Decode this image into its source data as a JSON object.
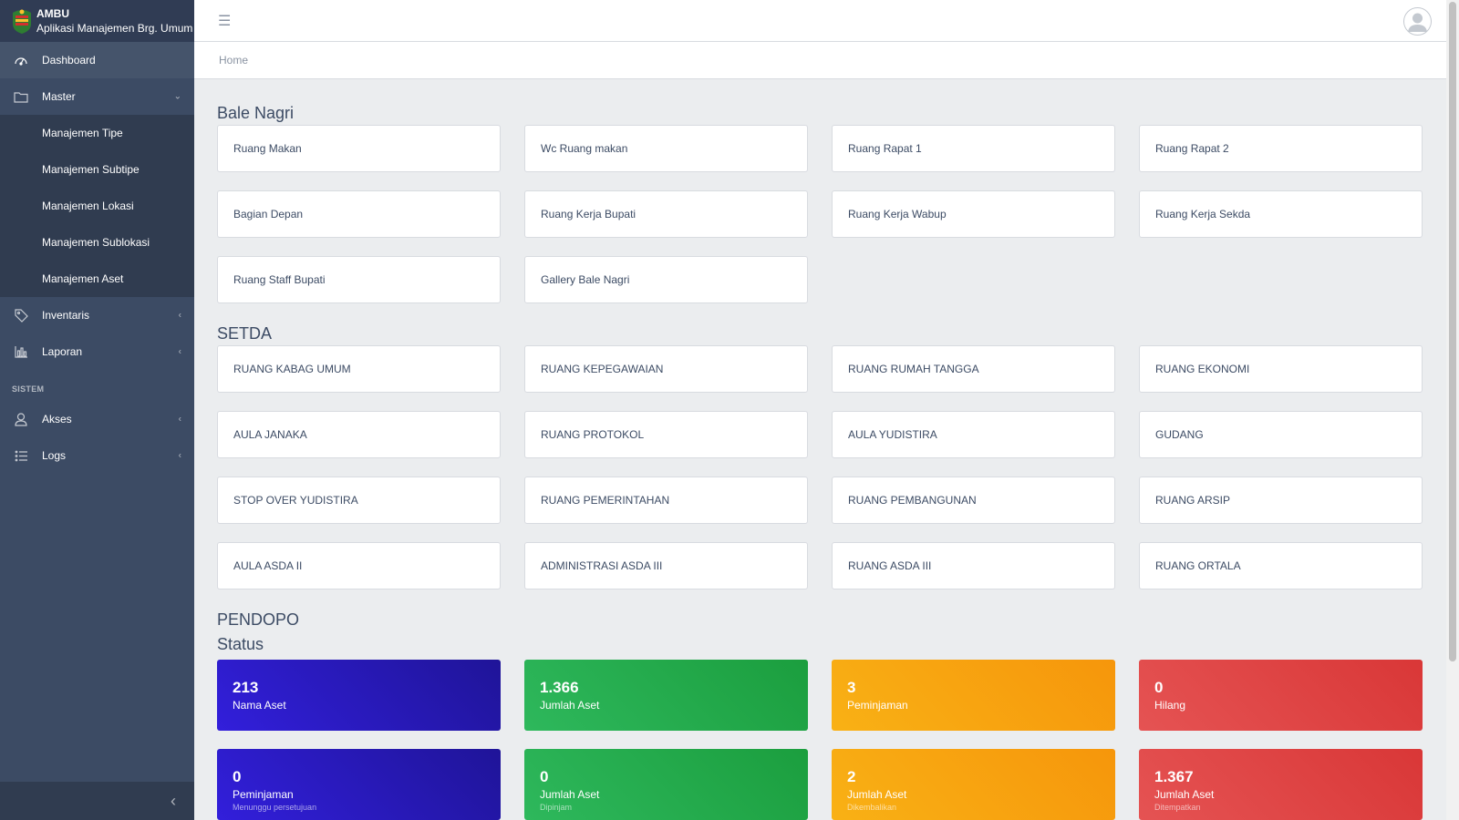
{
  "brand": {
    "title": "AMBU",
    "subtitle": "Aplikasi Manajemen Brg. Umum"
  },
  "sidebar": {
    "dashboard": "Dashboard",
    "master": "Master",
    "master_items": [
      "Manajemen Tipe",
      "Manajemen Subtipe",
      "Manajemen Lokasi",
      "Manajemen Sublokasi",
      "Manajemen Aset"
    ],
    "inventaris": "Inventaris",
    "laporan": "Laporan",
    "section_sistem": "SISTEM",
    "akses": "Akses",
    "logs": "Logs"
  },
  "breadcrumb": {
    "home": "Home"
  },
  "sections": [
    {
      "title": "Bale Nagri",
      "rooms": [
        "Ruang Makan",
        "Wc Ruang makan",
        "Ruang Rapat 1",
        "Ruang Rapat 2",
        "Bagian Depan",
        "Ruang Kerja Bupati",
        "Ruang Kerja Wabup",
        "Ruang Kerja Sekda",
        "Ruang Staff Bupati",
        "Gallery Bale Nagri"
      ]
    },
    {
      "title": "SETDA",
      "rooms": [
        "RUANG KABAG UMUM",
        "RUANG KEPEGAWAIAN",
        "RUANG RUMAH TANGGA",
        "RUANG EKONOMI",
        "AULA JANAKA",
        "RUANG PROTOKOL",
        "AULA YUDISTIRA",
        "GUDANG",
        "STOP OVER YUDISTIRA",
        "RUANG PEMERINTAHAN",
        "RUANG PEMBANGUNAN",
        "RUANG ARSIP",
        "AULA ASDA II",
        "ADMINISTRASI ASDA III",
        "RUANG ASDA III",
        "RUANG ORTALA"
      ]
    },
    {
      "title": "PENDOPO",
      "rooms": []
    }
  ],
  "status": {
    "title": "Status",
    "cards": [
      {
        "value": "213",
        "label": "Nama Aset",
        "sub": "",
        "color": "#321fdb"
      },
      {
        "value": "1.366",
        "label": "Jumlah Aset",
        "sub": "",
        "color": "#2eb85c"
      },
      {
        "value": "3",
        "label": "Peminjaman",
        "sub": "",
        "color": "#f9b115"
      },
      {
        "value": "0",
        "label": "Hilang",
        "sub": "",
        "color": "#e55353"
      },
      {
        "value": "0",
        "label": "Peminjaman",
        "sub": "Menunggu persetujuan",
        "color": "#321fdb"
      },
      {
        "value": "0",
        "label": "Jumlah Aset",
        "sub": "Dipinjam",
        "color": "#2eb85c"
      },
      {
        "value": "2",
        "label": "Jumlah Aset",
        "sub": "Dikembalikan",
        "color": "#f9b115"
      },
      {
        "value": "1.367",
        "label": "Jumlah Aset",
        "sub": "Ditempatkan",
        "color": "#e55353"
      }
    ]
  }
}
